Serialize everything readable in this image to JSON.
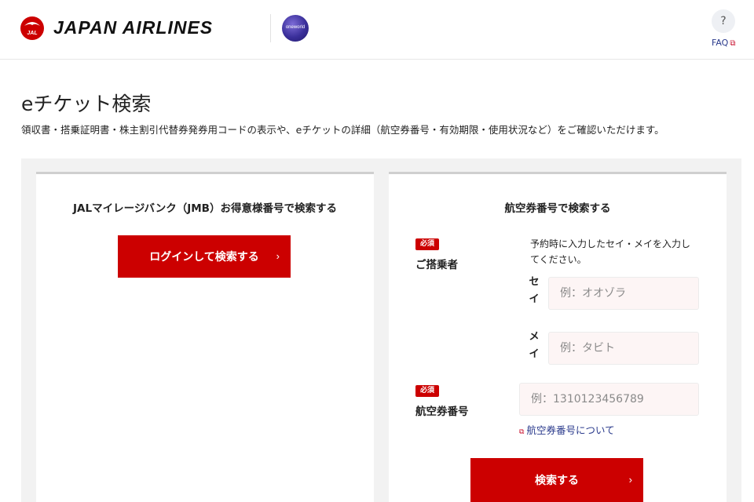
{
  "header": {
    "brand": "JAPAN AIRLINES",
    "logo_text": "JAL",
    "alliance_logo_text": "oneworld",
    "faq_icon": "?",
    "faq_label": "FAQ",
    "external_icon": "⧉"
  },
  "page": {
    "title": "eチケット検索",
    "description": "領収書・搭乗証明書・株主割引代替券発券用コードの表示や、eチケットの詳細（航空券番号・有効期限・使用状況など）をご確認いただけます。"
  },
  "jmb_panel": {
    "title": "JALマイレージバンク（JMB）お得意様番号で検索する",
    "login_button": "ログインして検索する",
    "chevron": "›"
  },
  "ticket_panel": {
    "title": "航空券番号で検索する",
    "required_badge": "必須",
    "passenger_label": "ご搭乗者",
    "passenger_hint": "予約時に入力したセイ・メイを入力してください。",
    "sei_label": "セイ",
    "sei_placeholder": "例：オオゾラ",
    "mei_label": "メイ",
    "mei_placeholder": "例：タビト",
    "ticket_label": "航空券番号",
    "ticket_placeholder": "例：1310123456789",
    "help_link": "航空券番号について",
    "search_button": "検索する",
    "chevron": "›"
  },
  "colors": {
    "accent": "#cc0000",
    "link": "#2a3a8c",
    "panel_bg": "#f2f2f2"
  }
}
